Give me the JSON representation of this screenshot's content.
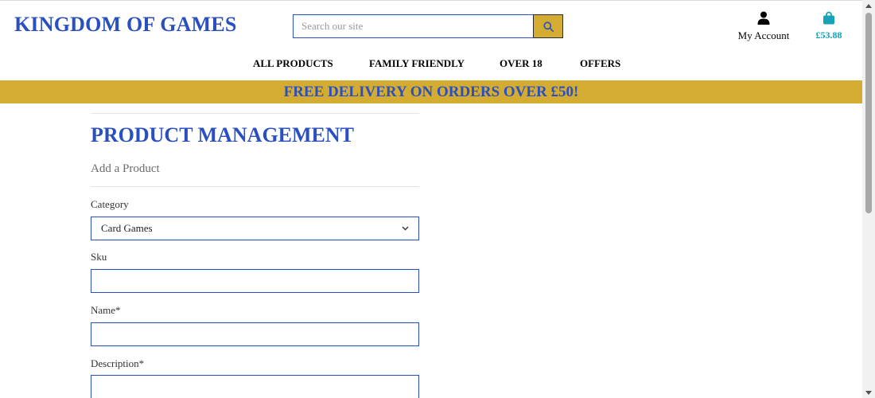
{
  "header": {
    "brand": "KINGDOM OF GAMES",
    "search": {
      "placeholder": "Search our site",
      "value": ""
    },
    "account_label": "My Account",
    "bag_total": "£53.88"
  },
  "nav": {
    "items": [
      "ALL PRODUCTS",
      "FAMILY FRIENDLY",
      "OVER 18",
      "OFFERS"
    ]
  },
  "banner": {
    "text": "FREE DELIVERY ON ORDERS OVER £50!"
  },
  "main": {
    "title": "PRODUCT MANAGEMENT",
    "subtitle": "Add a Product",
    "form": {
      "category": {
        "label": "Category",
        "selected": "Card Games"
      },
      "sku": {
        "label": "Sku",
        "value": ""
      },
      "name": {
        "label": "Name*",
        "value": ""
      },
      "description": {
        "label": "Description*",
        "value": ""
      }
    }
  },
  "colors": {
    "brand_blue": "#2a4fbf",
    "gold": "#d4ac32",
    "bag_teal": "#17a2b8"
  },
  "icons": {
    "search": "search-icon",
    "account": "user-icon",
    "bag": "shopping-bag-icon",
    "select_arrow": "chevron-down-icon"
  }
}
